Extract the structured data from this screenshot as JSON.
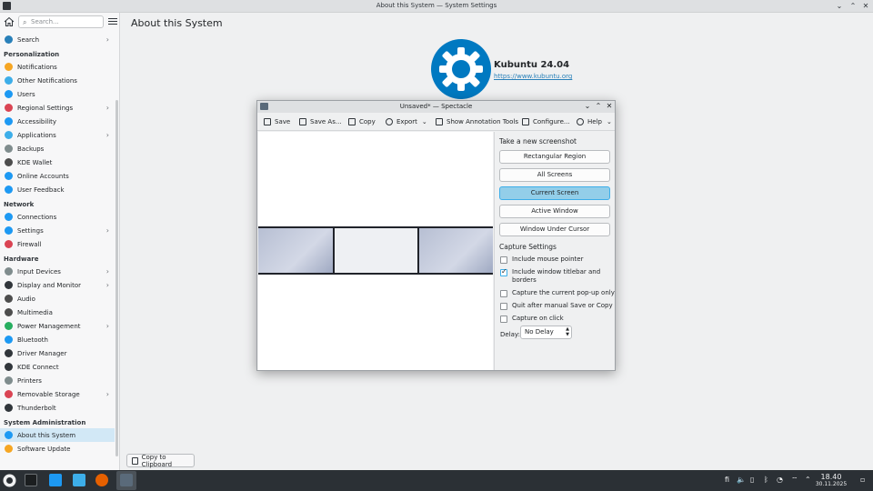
{
  "window": {
    "title": "About this System — System Settings"
  },
  "sidebar": {
    "search_placeholder": "Search...",
    "items": [
      {
        "type": "item",
        "label": "Search",
        "icon": "search-icon",
        "color": "#2980b9",
        "chevron": true
      },
      {
        "type": "section",
        "label": "Personalization"
      },
      {
        "type": "item",
        "label": "Notifications",
        "icon": "bell-icon",
        "color": "#f6a623"
      },
      {
        "type": "item",
        "label": "Other Notifications",
        "icon": "bell-settings-icon",
        "color": "#3daee9"
      },
      {
        "type": "item",
        "label": "Users",
        "icon": "user-icon",
        "color": "#1d99f3"
      },
      {
        "type": "item",
        "label": "Regional Settings",
        "icon": "flag-icon",
        "color": "#da4453",
        "chevron": true
      },
      {
        "type": "item",
        "label": "Accessibility",
        "icon": "accessibility-icon",
        "color": "#1d99f3"
      },
      {
        "type": "item",
        "label": "Applications",
        "icon": "applications-icon",
        "color": "#3daee9",
        "chevron": true
      },
      {
        "type": "item",
        "label": "Backups",
        "icon": "backup-icon",
        "color": "#7f8c8d"
      },
      {
        "type": "item",
        "label": "KDE Wallet",
        "icon": "wallet-icon",
        "color": "#4d4d4d"
      },
      {
        "type": "item",
        "label": "Online Accounts",
        "icon": "accounts-icon",
        "color": "#1d99f3"
      },
      {
        "type": "item",
        "label": "User Feedback",
        "icon": "feedback-icon",
        "color": "#1d99f3"
      },
      {
        "type": "section",
        "label": "Network"
      },
      {
        "type": "item",
        "label": "Connections",
        "icon": "network-icon",
        "color": "#1d99f3"
      },
      {
        "type": "item",
        "label": "Settings",
        "icon": "network-settings-icon",
        "color": "#1d99f3",
        "chevron": true
      },
      {
        "type": "item",
        "label": "Firewall",
        "icon": "firewall-icon",
        "color": "#da4453"
      },
      {
        "type": "section",
        "label": "Hardware"
      },
      {
        "type": "item",
        "label": "Input Devices",
        "icon": "keyboard-icon",
        "color": "#7f8c8d",
        "chevron": true
      },
      {
        "type": "item",
        "label": "Display and Monitor",
        "icon": "monitor-icon",
        "color": "#31363b",
        "chevron": true
      },
      {
        "type": "item",
        "label": "Audio",
        "icon": "audio-icon",
        "color": "#4d4d4d"
      },
      {
        "type": "item",
        "label": "Multimedia",
        "icon": "multimedia-icon",
        "color": "#4d4d4d"
      },
      {
        "type": "item",
        "label": "Power Management",
        "icon": "power-icon",
        "color": "#27ae60",
        "chevron": true
      },
      {
        "type": "item",
        "label": "Bluetooth",
        "icon": "bluetooth-icon",
        "color": "#1d99f3"
      },
      {
        "type": "item",
        "label": "Driver Manager",
        "icon": "driver-icon",
        "color": "#31363b"
      },
      {
        "type": "item",
        "label": "KDE Connect",
        "icon": "kde-connect-icon",
        "color": "#31363b"
      },
      {
        "type": "item",
        "label": "Printers",
        "icon": "printer-icon",
        "color": "#7f8c8d"
      },
      {
        "type": "item",
        "label": "Removable Storage",
        "icon": "usb-icon",
        "color": "#da4453",
        "chevron": true
      },
      {
        "type": "item",
        "label": "Thunderbolt",
        "icon": "thunderbolt-icon",
        "color": "#31363b"
      },
      {
        "type": "section",
        "label": "System Administration"
      },
      {
        "type": "item",
        "label": "About this System",
        "icon": "info-icon",
        "color": "#1d99f3",
        "selected": true
      },
      {
        "type": "item",
        "label": "Software Update",
        "icon": "update-icon",
        "color": "#f6a623"
      }
    ]
  },
  "main": {
    "page_title": "About this System",
    "distro_name": "Kubuntu 24.04",
    "distro_url": "https://www.kubuntu.org",
    "copy_button": "Copy to Clipboard"
  },
  "spectacle": {
    "title": "Unsaved* — Spectacle",
    "toolbar": {
      "save": "Save",
      "save_as": "Save As...",
      "copy": "Copy",
      "export": "Export",
      "annotate": "Show Annotation Tools",
      "configure": "Configure...",
      "help": "Help"
    },
    "new_heading": "Take a new screenshot",
    "modes": [
      "Rectangular Region",
      "All Screens",
      "Current Screen",
      "Active Window",
      "Window Under Cursor"
    ],
    "active_mode": "Current Screen",
    "settings_heading": "Capture Settings",
    "options": [
      {
        "label": "Include mouse pointer",
        "checked": false
      },
      {
        "label": "Include window titlebar and borders",
        "checked": true
      },
      {
        "label": "Capture the current pop-up only",
        "checked": false
      },
      {
        "label": "Quit after manual Save or Copy",
        "checked": false
      },
      {
        "label": "Capture on click",
        "checked": false
      }
    ],
    "delay_label": "Delay:",
    "delay_value": "No Delay"
  },
  "taskbar": {
    "keyboard_layout": "fi",
    "time": "18.40",
    "date": "30.11.2025"
  }
}
